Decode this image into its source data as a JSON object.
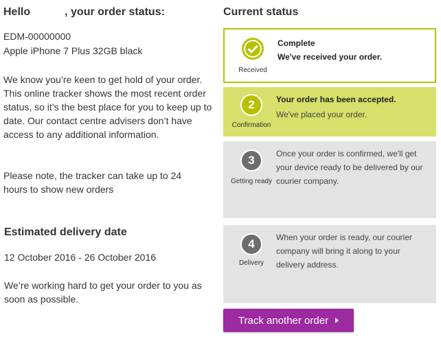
{
  "greeting": {
    "prefix": "Hello",
    "suffix": ", your order status:"
  },
  "order": {
    "number": "EDM-00000000 ",
    "device": "Apple iPhone 7 Plus 32GB black"
  },
  "intro_text": "We know you’re keen to get hold of your order. This online tracker shows the most recent order status, so it’s the best place for you to keep up to date. Our contact centre advisers don’t have access to any additional information.",
  "tracker_note": "Please note, the tracker can take up to 24 hours to show new orders",
  "estimate": {
    "title": "Estimated delivery date",
    "range": "12 October 2016 - 26 October 2016",
    "note": "We’re working hard to get your order to you as soon as possible."
  },
  "status": {
    "title": "Current status",
    "steps": [
      {
        "number": "✓",
        "label": "Received",
        "heading": "Complete",
        "detail": "We've received your order.",
        "state": "complete"
      },
      {
        "number": "2",
        "label": "Confirmation",
        "heading": "Your order has been accepted.",
        "detail": "We've placed your order.",
        "state": "current"
      },
      {
        "number": "3",
        "label": "Getting ready",
        "detail": "Once your order is confirmed, we'll get your device ready to be delivered by our courier company.",
        "state": "pending"
      },
      {
        "number": "4",
        "label": "Delivery",
        "detail": "When your order is ready, our courier company will bring it along to your delivery address.",
        "state": "pending"
      }
    ]
  },
  "actions": {
    "track_another": "Track another order"
  },
  "colors": {
    "complete": "#b5c200",
    "current_bg": "#d6e06a",
    "pending_bg": "#e3e3e3",
    "pending_circle": "#6d6d6d",
    "button": "#9c2aa0"
  }
}
